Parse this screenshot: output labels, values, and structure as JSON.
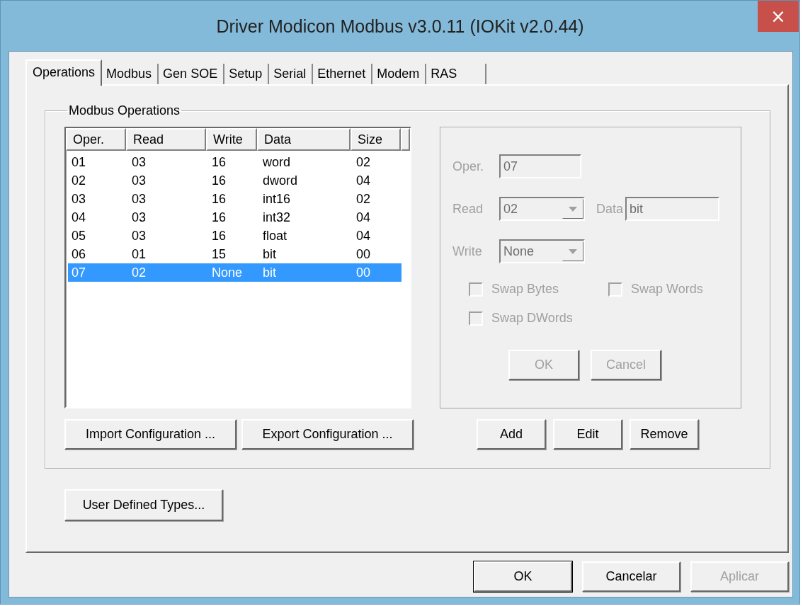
{
  "window": {
    "title": "Driver Modicon Modbus v3.0.11 (IOKit v2.0.44)",
    "close": "×"
  },
  "tabs": [
    {
      "label": "Operations",
      "selected": true
    },
    {
      "label": "Modbus",
      "selected": false
    },
    {
      "label": "Gen SOE",
      "selected": false
    },
    {
      "label": "Setup",
      "selected": false
    },
    {
      "label": "Serial",
      "selected": false
    },
    {
      "label": "Ethernet",
      "selected": false
    },
    {
      "label": "Modem",
      "selected": false
    },
    {
      "label": "RAS",
      "selected": false
    }
  ],
  "group": {
    "title": "Modbus Operations"
  },
  "table": {
    "columns": [
      "Oper.",
      "Read",
      "Write",
      "Data",
      "Size"
    ],
    "rows": [
      {
        "cells": [
          "01",
          "03",
          "16",
          "word",
          "02"
        ],
        "selected": false
      },
      {
        "cells": [
          "02",
          "03",
          "16",
          "dword",
          "04"
        ],
        "selected": false
      },
      {
        "cells": [
          "03",
          "03",
          "16",
          "int16",
          "02"
        ],
        "selected": false
      },
      {
        "cells": [
          "04",
          "03",
          "16",
          "int32",
          "04"
        ],
        "selected": false
      },
      {
        "cells": [
          "05",
          "03",
          "16",
          "float",
          "04"
        ],
        "selected": false
      },
      {
        "cells": [
          "06",
          "01",
          "15",
          "bit",
          "00"
        ],
        "selected": false
      },
      {
        "cells": [
          "07",
          "02",
          "None",
          "bit",
          "00"
        ],
        "selected": true
      }
    ]
  },
  "editor": {
    "rows": [
      {
        "fields": [
          {
            "kind": "text",
            "label": "Oper.",
            "value": "07",
            "disabled": true
          }
        ]
      },
      {
        "fields": [
          {
            "kind": "combo",
            "label": "Read",
            "value": "02",
            "disabled": true
          },
          {
            "kind": "text",
            "label": "Data",
            "value": "bit",
            "disabled": true
          }
        ]
      },
      {
        "fields": [
          {
            "kind": "combo",
            "label": "Write",
            "value": "None",
            "disabled": true
          }
        ]
      }
    ],
    "checkboxes": [
      {
        "label": "Swap Bytes",
        "checked": false,
        "disabled": true
      },
      {
        "label": "Swap Words",
        "checked": false,
        "disabled": true
      },
      {
        "label": "Swap DWords",
        "checked": false,
        "disabled": true
      }
    ],
    "buttons": [
      {
        "label": "OK",
        "disabled": true
      },
      {
        "label": "Cancel",
        "disabled": true
      }
    ]
  },
  "list_buttons": [
    {
      "label": "Import Configuration ...",
      "disabled": false
    },
    {
      "label": "Export Configuration ...",
      "disabled": false
    }
  ],
  "action_buttons": [
    {
      "label": "Add",
      "disabled": false
    },
    {
      "label": "Edit",
      "disabled": false
    },
    {
      "label": "Remove",
      "disabled": false
    }
  ],
  "extra_buttons": [
    {
      "label": "User Defined Types...",
      "disabled": false
    }
  ],
  "footer_buttons": [
    {
      "label": "OK",
      "disabled": false,
      "default": true
    },
    {
      "label": "Cancelar",
      "disabled": false,
      "default": false
    },
    {
      "label": "Aplicar",
      "disabled": true,
      "default": false
    }
  ]
}
